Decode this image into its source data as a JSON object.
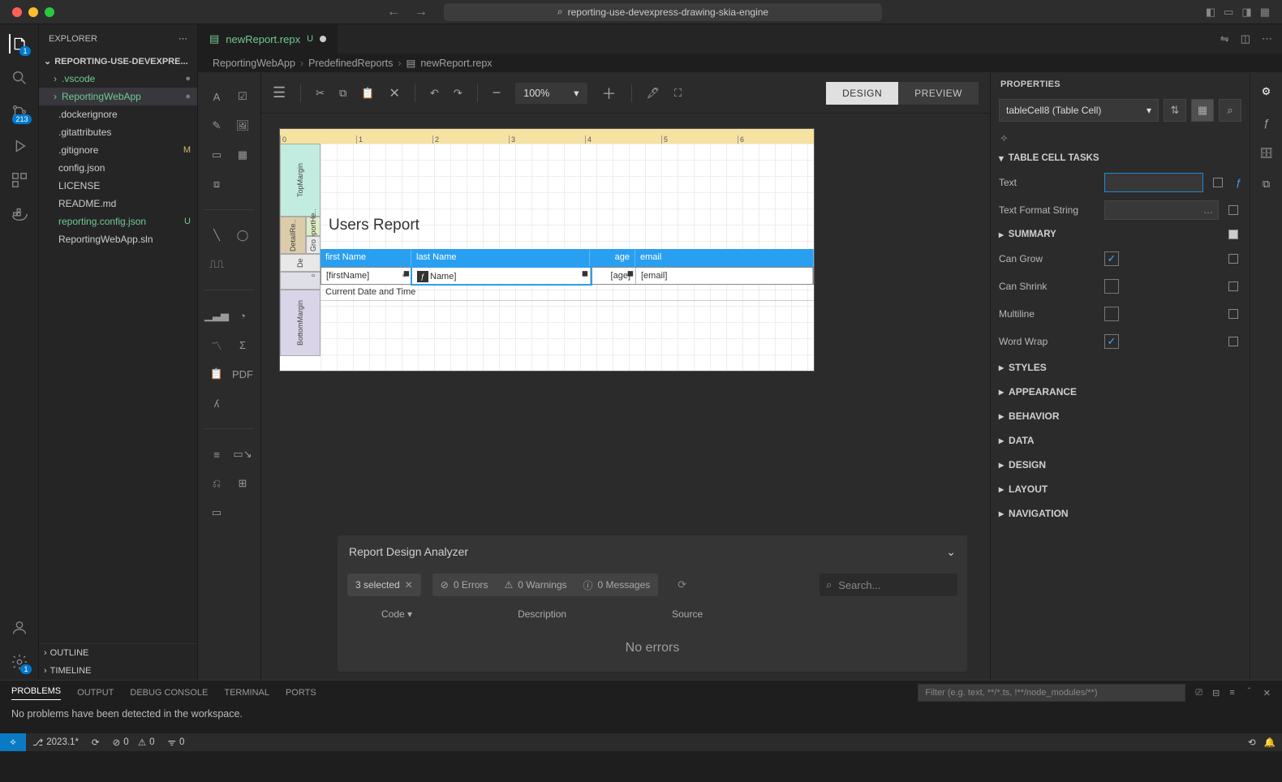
{
  "titlebar": {
    "url": "reporting-use-devexpress-drawing-skia-engine"
  },
  "activity": {
    "explorerBadge": "1",
    "scmBadge": "213"
  },
  "sidebar": {
    "title": "EXPLORER",
    "root": "REPORTING-USE-DEVEXPRE...",
    "tree": [
      {
        "name": ".vscode",
        "stat": "●",
        "cls": "green folder"
      },
      {
        "name": "ReportingWebApp",
        "stat": "●",
        "cls": "green folder sel"
      },
      {
        "name": ".dockerignore",
        "stat": "",
        "cls": ""
      },
      {
        "name": ".gitattributes",
        "stat": "",
        "cls": ""
      },
      {
        "name": ".gitignore",
        "stat": "M",
        "cls": "modified"
      },
      {
        "name": "config.json",
        "stat": "",
        "cls": ""
      },
      {
        "name": "LICENSE",
        "stat": "",
        "cls": ""
      },
      {
        "name": "README.md",
        "stat": "",
        "cls": ""
      },
      {
        "name": "reporting.config.json",
        "stat": "U",
        "cls": "untracked green"
      },
      {
        "name": "ReportingWebApp.sln",
        "stat": "",
        "cls": ""
      }
    ],
    "outline": "OUTLINE",
    "timeline": "TIMELINE"
  },
  "tab": {
    "name": "newReport.repx",
    "stat": "U"
  },
  "crumbs": [
    "ReportingWebApp",
    "PredefinedReports",
    "newReport.repx"
  ],
  "toolbar": {
    "zoom": "100%",
    "design": "DESIGN",
    "preview": "PREVIEW"
  },
  "report": {
    "title": "Users Report",
    "cols": [
      "first Name",
      "last Name",
      "age",
      "email"
    ],
    "vals": [
      "[firstName]",
      "Name]",
      "[age]",
      "[email]"
    ],
    "footer": "Current Date and Time"
  },
  "analyzer": {
    "title": "Report Design Analyzer",
    "selected": "3 selected",
    "errors": "0 Errors",
    "warnings": "0 Warnings",
    "messages": "0 Messages",
    "search": "Search...",
    "cols": [
      "Code",
      "Description",
      "Source"
    ],
    "body": "No errors"
  },
  "props": {
    "title": "PROPERTIES",
    "selection": "tableCell8 (Table Cell)",
    "taskHdr": "TABLE CELL TASKS",
    "rows": {
      "text": "Text",
      "fmt": "Text Format String",
      "summary": "SUMMARY",
      "grow": "Can Grow",
      "shrink": "Can Shrink",
      "multiline": "Multiline",
      "wrap": "Word Wrap"
    },
    "groups": [
      "STYLES",
      "APPEARANCE",
      "BEHAVIOR",
      "DATA",
      "DESIGN",
      "LAYOUT",
      "NAVIGATION"
    ]
  },
  "terminal": {
    "tabs": [
      "PROBLEMS",
      "OUTPUT",
      "DEBUG CONSOLE",
      "TERMINAL",
      "PORTS"
    ],
    "filter": "Filter (e.g. text, **/*.ts, !**/node_modules/**)",
    "body": "No problems have been detected in the workspace."
  },
  "status": {
    "branch": "2023.1*",
    "sync": "",
    "err": "0",
    "warn": "0",
    "port": "0"
  }
}
